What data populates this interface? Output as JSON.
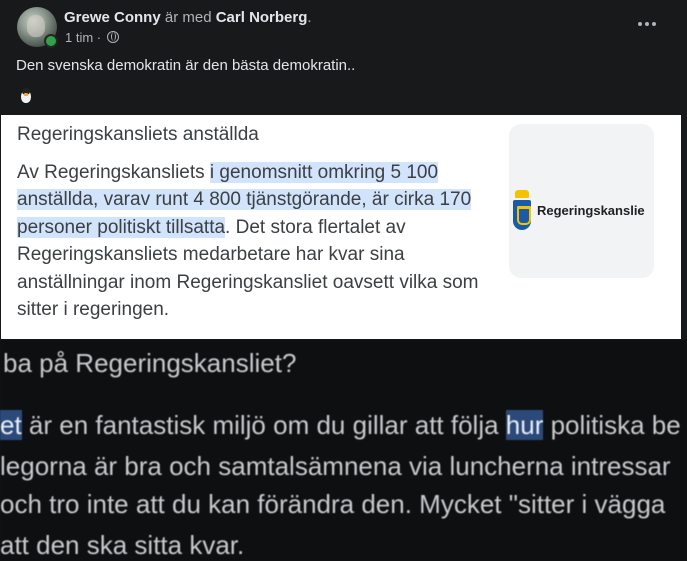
{
  "post": {
    "author": "Grewe Conny",
    "with_text": "är med",
    "tagged": "Carl Norberg",
    "period": ".",
    "time": "1 tim",
    "separator": "·",
    "text": "Den svenska demokratin är den bästa demokratin.."
  },
  "image1": {
    "heading": "Regeringskansliets anställda",
    "para_part1": "Av Regeringskansliets ",
    "para_highlight": "i genomsnitt omkring 5 100 anställda, varav runt 4 800 tjänstgörande, är cirka 170 personer politiskt tillsatta",
    "para_part2": ". Det stora flertalet av Regeringskansliets medarbetare har kvar sina anställningar inom Regeringskansliet oavsett vilka som sitter i regeringen.",
    "logo_text": "Regeringskanslie"
  },
  "image2": {
    "question": "ba på Regeringskansliet?",
    "line1_hl": "et",
    "line1_a": " är en fantastisk miljö om du gillar att följa ",
    "line1_hl2": "hur",
    "line1_b": " politiska be",
    "line2": "legorna är bra och samtalsämnena via luncherna intressar",
    "line3": " och tro inte att du kan förändra den. Mycket \"sitter i väggа",
    "line4": " att den ska sitta kvar."
  },
  "colors": {
    "background": "#18191a",
    "online": "#31a24c",
    "highlight": "#d2e3fc"
  },
  "icons": [
    "globe-icon",
    "more-options-icon",
    "penguin-emoji"
  ]
}
